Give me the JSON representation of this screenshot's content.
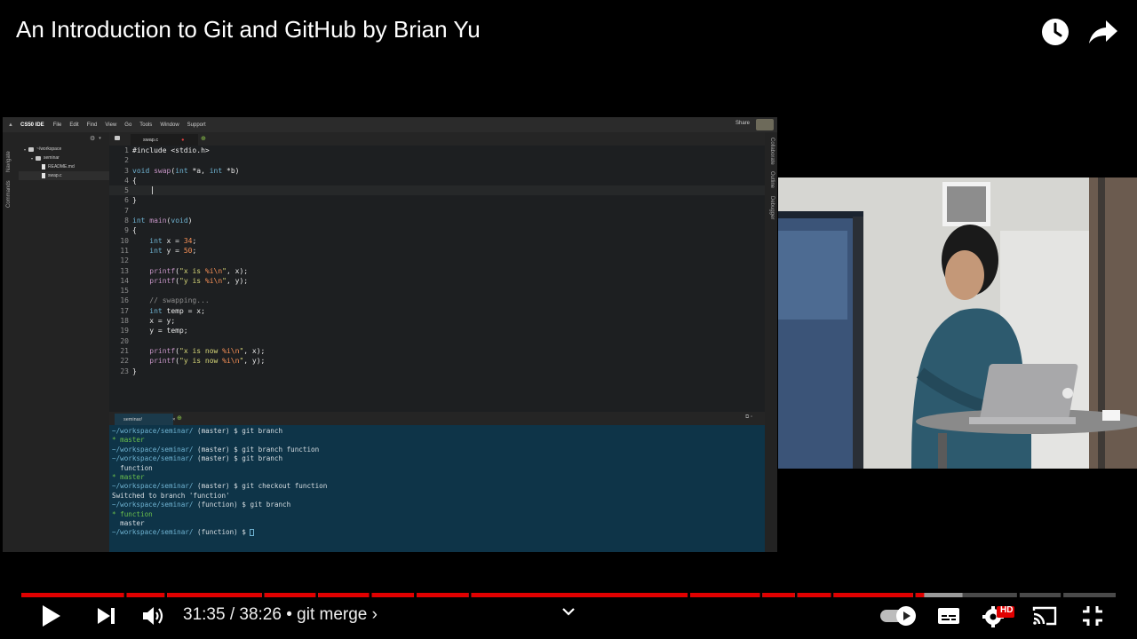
{
  "video": {
    "title": "An Introduction to Git and GitHub by Brian Yu"
  },
  "top_actions": {
    "watch_later_icon": "clock-icon",
    "share_icon": "share-arrow-icon"
  },
  "ide": {
    "brand": "CS50 IDE",
    "menus": [
      "File",
      "Edit",
      "Find",
      "View",
      "Go",
      "Tools",
      "Window",
      "Support"
    ],
    "share_label": "Share",
    "left_panels": [
      "Navigate",
      "Commands"
    ],
    "right_panels": [
      "Collaborate",
      "Outline",
      "Debugger"
    ],
    "tree": {
      "root": "~/workspace",
      "folder": "seminar",
      "files": [
        "README.md",
        "swap.c"
      ]
    },
    "editor_tab": "swap.c",
    "code_lines": [
      "#include <stdio.h>",
      "",
      "void swap(int *a, int *b)",
      "{",
      "",
      "}",
      "",
      "int main(void)",
      "{",
      "    int x = 34;",
      "    int y = 50;",
      "",
      "    printf(\"x is %i\\n\", x);",
      "    printf(\"y is %i\\n\", y);",
      "",
      "    // swapping...",
      "    int temp = x;",
      "    x = y;",
      "    y = temp;",
      "",
      "    printf(\"x is now %i\\n\", x);",
      "    printf(\"y is now %i\\n\", y);",
      "}"
    ],
    "current_line": 5,
    "terminal_tab": "seminar/",
    "terminal_lines": [
      {
        "path": "~/workspace/seminar/",
        "rest": " (master) $ git branch"
      },
      {
        "green": "* master"
      },
      {
        "path": "~/workspace/seminar/",
        "rest": " (master) $ git branch function"
      },
      {
        "path": "~/workspace/seminar/",
        "rest": " (master) $ git branch"
      },
      {
        "text": "  function"
      },
      {
        "green": "* master"
      },
      {
        "path": "~/workspace/seminar/",
        "rest": " (master) $ git checkout function"
      },
      {
        "text": "Switched to branch 'function'"
      },
      {
        "path": "~/workspace/seminar/",
        "rest": " (function) $ git branch"
      },
      {
        "green": "* function"
      },
      {
        "text": "  master"
      },
      {
        "path": "~/workspace/seminar/",
        "rest": " (function) $ ",
        "cursor": true
      }
    ]
  },
  "player": {
    "played_fraction": 0.825,
    "buffered_fraction": 0.86,
    "chapter_breaks": [
      0.095,
      0.132,
      0.221,
      0.27,
      0.319,
      0.36,
      0.41,
      0.61,
      0.676,
      0.708,
      0.741,
      0.816,
      0.911,
      0.951
    ],
    "time_current": "31:35",
    "time_total": "38:26",
    "chapter": "git merge",
    "time_separator": " / ",
    "chapter_separator": " • ",
    "chapter_chevron": "›",
    "colors": {
      "played": "#e00000",
      "buffered": "#9a9a9a",
      "track": "#4a4a4a"
    },
    "icons": [
      "play-icon",
      "next-icon",
      "volume-icon",
      "chevron-down-icon",
      "autoplay-toggle-icon",
      "captions-icon",
      "settings-hd-icon",
      "cast-icon",
      "fullscreen-exit-icon"
    ],
    "hd_badge": "HD"
  }
}
